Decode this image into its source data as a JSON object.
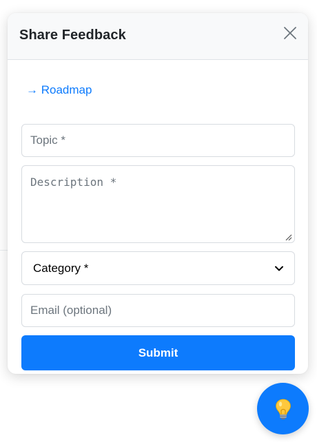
{
  "panel": {
    "title": "Share Feedback",
    "close_icon": "close-icon"
  },
  "roadmap_link": {
    "label": "→ Roadmap"
  },
  "form": {
    "topic_placeholder": "Topic *",
    "description_placeholder": "Description *",
    "category_selected": "Category *",
    "email_placeholder": "Email (optional)",
    "submit_label": "Submit"
  },
  "fab": {
    "icon": "lightbulb-icon"
  },
  "colors": {
    "accent": "#0d7bfd",
    "header_bg": "#f8f9fa",
    "border": "#d7dbe0"
  }
}
